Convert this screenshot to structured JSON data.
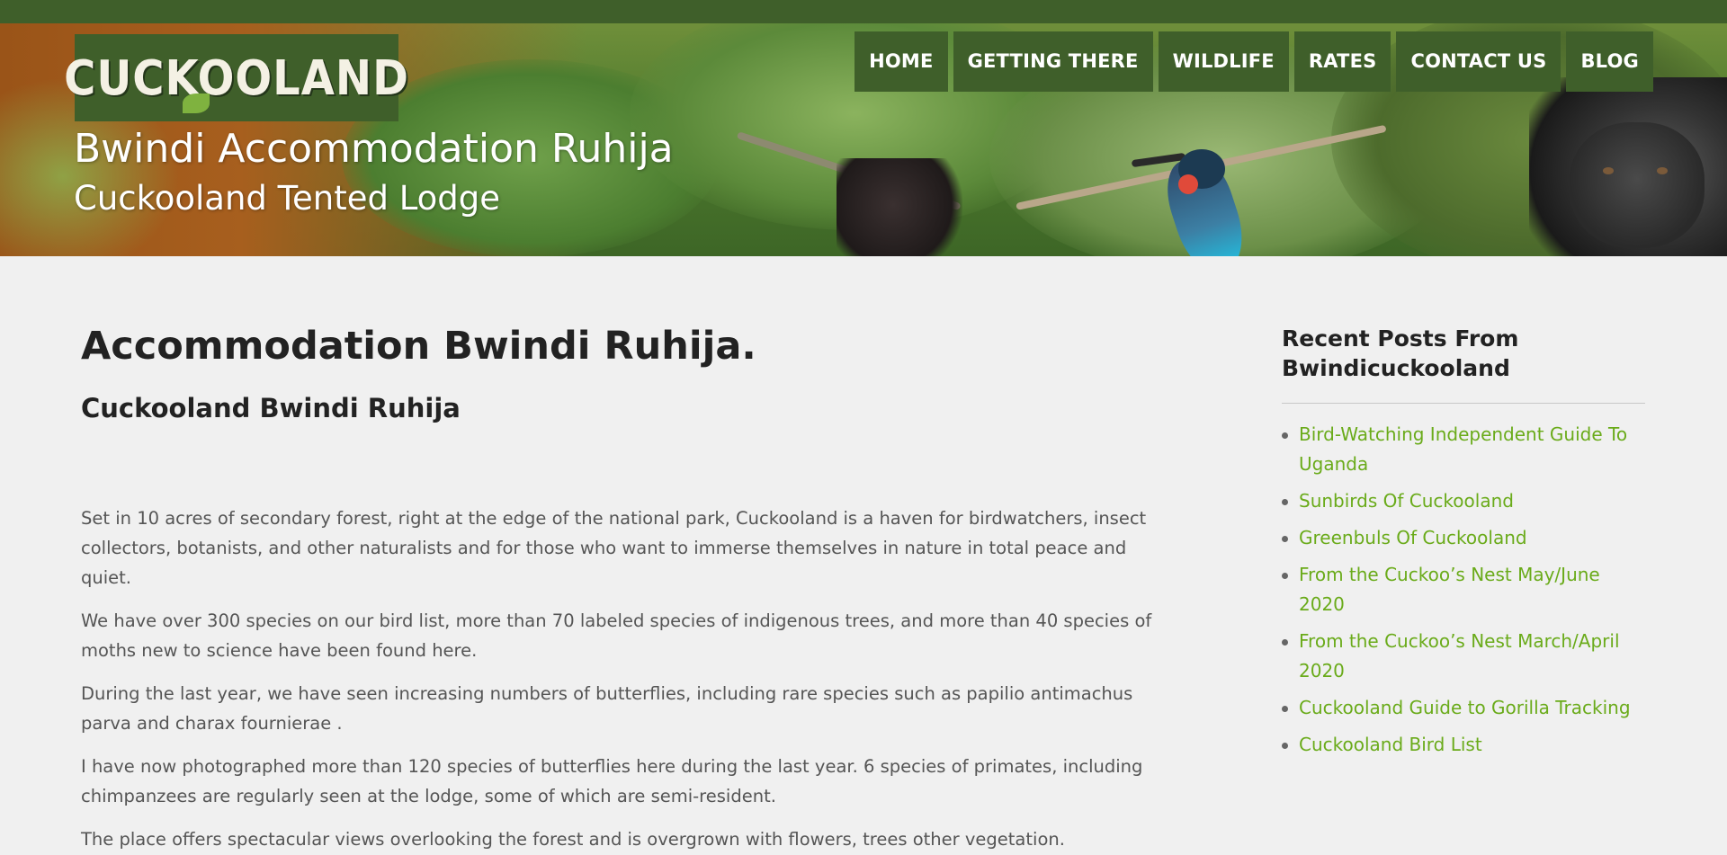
{
  "header": {
    "logo_text": "CUCKOOLAND",
    "site_title": "Bwindi Accommodation Ruhija",
    "tagline": "Cuckooland Tented Lodge"
  },
  "nav": {
    "items": [
      {
        "label": "HOME"
      },
      {
        "label": "GETTING THERE"
      },
      {
        "label": "WILDLIFE"
      },
      {
        "label": "RATES"
      },
      {
        "label": "CONTACT US"
      },
      {
        "label": "BLOG"
      }
    ]
  },
  "main": {
    "title": "Accommodation Bwindi Ruhija.",
    "subtitle": "Cuckooland Bwindi Ruhija",
    "paragraphs": [
      "Set in 10 acres of secondary forest, right at the edge of the national park, Cuckooland is a haven for birdwatchers, insect collectors, botanists, and other naturalists and for those who want to immerse themselves in nature in total peace and quiet.",
      "We have over 300 species on our bird list, more than 70 labeled species of indigenous trees, and more than 40 species of moths new to science have been found here.",
      "During the last year, we have seen increasing numbers of butterflies, including rare species such as papilio antimachus parva and charax fournierae .",
      "I have now photographed more than 120 species of butterflies here during the last year. 6 species of primates, including chimpanzees are regularly seen at the lodge, some of which are semi-resident.",
      "The place offers spectacular views overlooking the forest and is overgrown with flowers, trees other vegetation."
    ]
  },
  "sidebar": {
    "heading": "Recent Posts From Bwindicuckooland",
    "posts": [
      {
        "label": "Bird-Watching Independent Guide To Uganda"
      },
      {
        "label": "Sunbirds Of Cuckooland"
      },
      {
        "label": "Greenbuls Of Cuckooland"
      },
      {
        "label": "From the Cuckoo’s Nest May/June 2020"
      },
      {
        "label": "From the Cuckoo’s Nest March/April 2020"
      },
      {
        "label": "Cuckooland Guide to Gorilla Tracking"
      },
      {
        "label": "Cuckooland Bird List"
      }
    ]
  },
  "colors": {
    "nav_bg": "#3f5f2a",
    "link": "#6aab1a",
    "page_bg": "#f0f0f0",
    "banner_brown": "#a75f1e"
  },
  "icons": [
    "logo-leaf-icon",
    "bullet-icon"
  ]
}
